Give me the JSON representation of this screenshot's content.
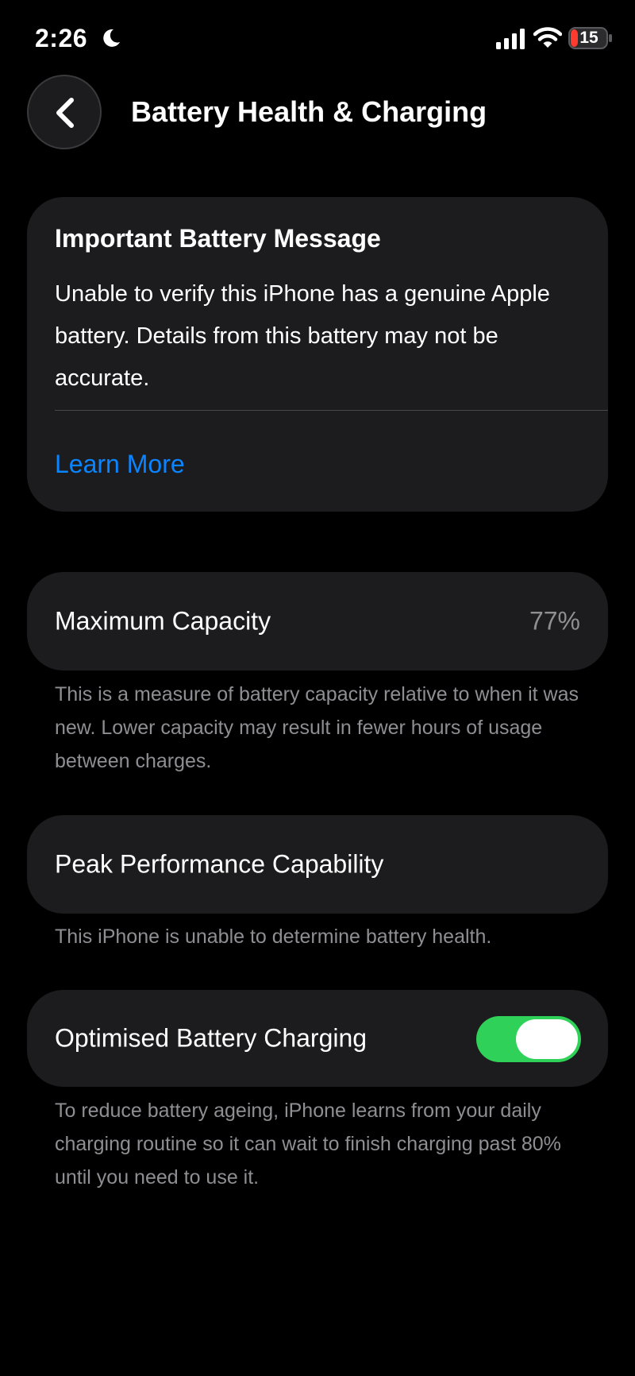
{
  "status_bar": {
    "time": "2:26",
    "battery_level": "15",
    "focus_icon": "moon-icon",
    "icons": [
      "signal-icon",
      "wifi-icon",
      "battery-icon"
    ]
  },
  "header": {
    "back_icon": "chevron-left-icon",
    "title": "Battery Health & Charging"
  },
  "message_card": {
    "title": "Important Battery Message",
    "body": "Unable to verify this iPhone has a genuine Apple battery. Details from this battery may not be accurate.",
    "link_label": "Learn More"
  },
  "maximum_capacity": {
    "label": "Maximum Capacity",
    "value": "77%",
    "note": "This is a measure of battery capacity relative to when it was new. Lower capacity may result in fewer hours of usage between charges."
  },
  "peak_performance": {
    "label": "Peak Performance Capability",
    "note": "This iPhone is unable to determine battery health."
  },
  "optimised_charging": {
    "label": "Optimised Battery Charging",
    "enabled": true,
    "note": "To reduce battery ageing, iPhone learns from your daily charging routine so it can wait to finish charging past 80% until you need to use it."
  },
  "colors": {
    "background": "#000000",
    "card": "#1c1c1e",
    "link": "#0a84ff",
    "toggle_on": "#30d158",
    "secondary_text": "#8e8e93",
    "battery_low": "#ff3b30"
  }
}
